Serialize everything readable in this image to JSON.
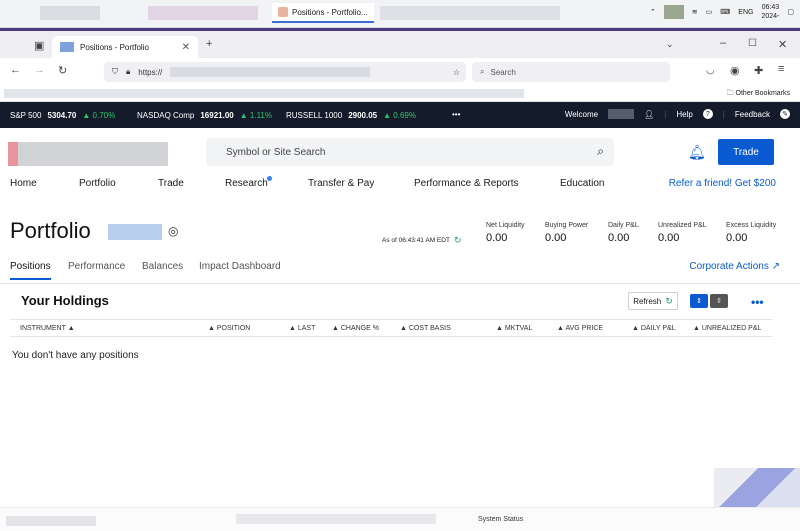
{
  "os": {
    "active_window_title": "Positions - Portfolio...",
    "clock_time": "06:43",
    "clock_date": "2024-",
    "lang": "ENG"
  },
  "browser": {
    "tab_title": "Positions - Portfolio",
    "url": "https://",
    "search_placeholder": "Search",
    "other_bookmarks": "Other Bookmarks"
  },
  "ticker": {
    "items": [
      {
        "name": "S&P 500",
        "value": "5304.70",
        "change": "0.70%"
      },
      {
        "name": "NASDAQ Comp",
        "value": "16921.00",
        "change": "1.11%"
      },
      {
        "name": "RUSSELL 1000",
        "value": "2900.05",
        "change": "0.69%"
      }
    ],
    "more": "•••",
    "welcome": "Welcome",
    "help": "Help",
    "feedback": "Feedback"
  },
  "header": {
    "search_placeholder": "Symbol or Site Search",
    "trade_label": "Trade",
    "nav": [
      "Home",
      "Portfolio",
      "Trade",
      "Research",
      "Transfer & Pay",
      "Performance & Reports",
      "Education"
    ],
    "refer": "Refer a friend! Get $200"
  },
  "portfolio": {
    "title": "Portfolio",
    "as_of": "As of 06:43:41 AM EDT",
    "metrics": [
      {
        "label": "Net Liquidity",
        "value": "0.00"
      },
      {
        "label": "Buying Power",
        "value": "0.00"
      },
      {
        "label": "Daily P&L",
        "value": "0.00"
      },
      {
        "label": "Unrealized P&L",
        "value": "0.00"
      },
      {
        "label": "Excess Liquidity",
        "value": "0.00"
      }
    ],
    "tabs": [
      "Positions",
      "Performance",
      "Balances",
      "Impact Dashboard"
    ],
    "corporate_actions": "Corporate Actions ↗"
  },
  "holdings": {
    "title": "Your Holdings",
    "refresh": "Refresh",
    "columns": [
      "INSTRUMENT ▲",
      "▲ POSITION",
      "▲ LAST",
      "▲ CHANGE %",
      "▲ COST BASIS",
      "▲ MKTVAL",
      "▲ AVG PRICE",
      "▲ DAILY P&L",
      "▲ UNREALIZED P&L"
    ],
    "empty": "You don't have any positions"
  },
  "footer": {
    "system_status": "System Status"
  },
  "colors": {
    "accent": "#0a5bd2",
    "ticker_bg": "#141c2c",
    "up": "#30c46a"
  }
}
